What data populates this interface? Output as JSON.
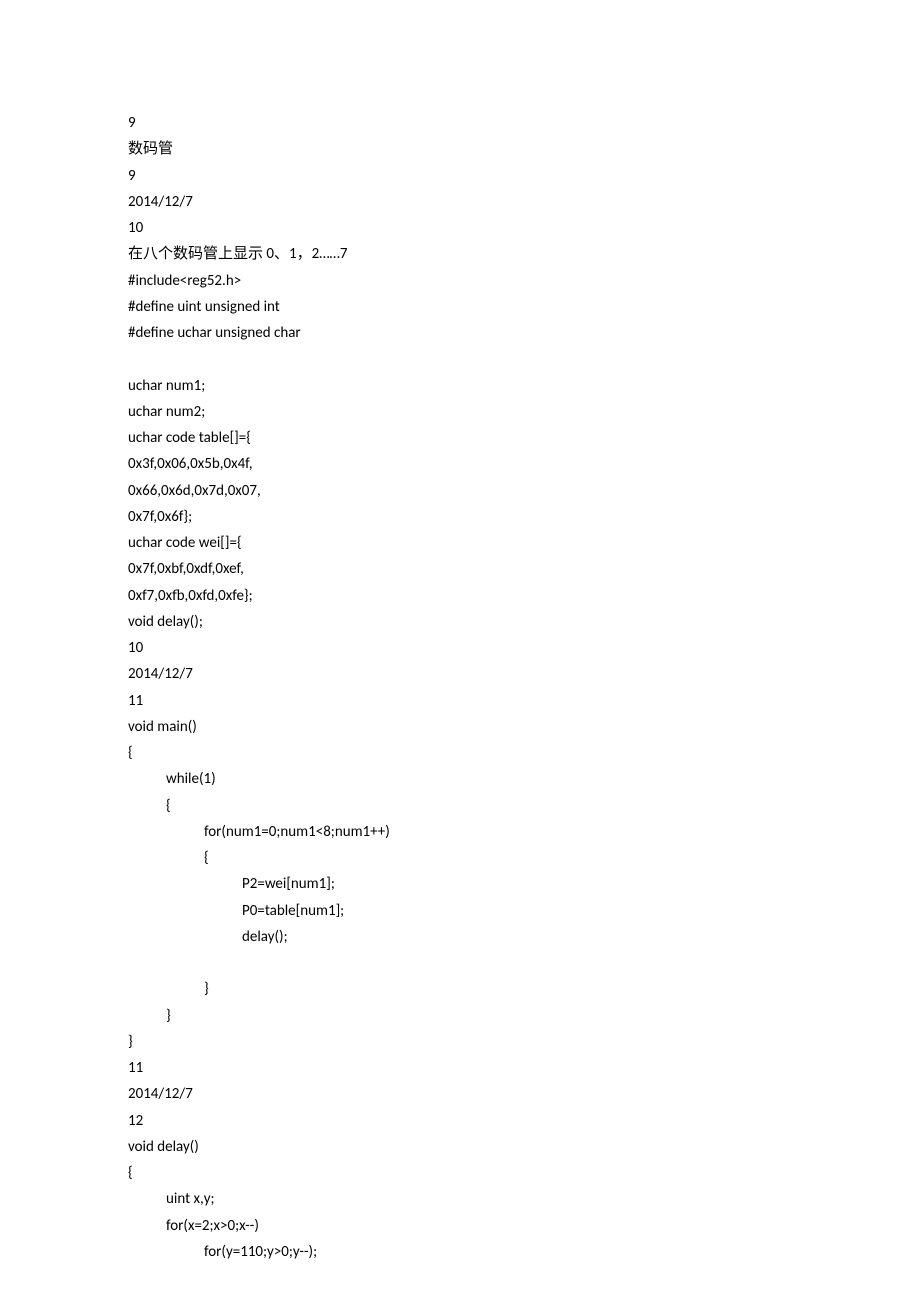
{
  "lines": [
    {
      "text": "9",
      "indent": 0
    },
    {
      "text": "数码管",
      "indent": 0
    },
    {
      "text": "9",
      "indent": 0
    },
    {
      "text": "2014/12/7",
      "indent": 0
    },
    {
      "text": "10",
      "indent": 0
    },
    {
      "text": "在八个数码管上显示 0、1，2……7",
      "indent": 0
    },
    {
      "text": "#include<reg52.h>",
      "indent": 0
    },
    {
      "text": "#define uint unsigned int",
      "indent": 0
    },
    {
      "text": "#define uchar unsigned char",
      "indent": 0
    },
    {
      "text": " ",
      "indent": 0
    },
    {
      "text": "uchar num1;",
      "indent": 0
    },
    {
      "text": "uchar num2;",
      "indent": 0
    },
    {
      "text": "uchar code table[]={",
      "indent": 0
    },
    {
      "text": "0x3f,0x06,0x5b,0x4f,",
      "indent": 0
    },
    {
      "text": "0x66,0x6d,0x7d,0x07,",
      "indent": 0
    },
    {
      "text": "0x7f,0x6f};",
      "indent": 0
    },
    {
      "text": "uchar code wei[]={",
      "indent": 0
    },
    {
      "text": "0x7f,0xbf,0xdf,0xef,",
      "indent": 0
    },
    {
      "text": "0xf7,0xfb,0xfd,0xfe};",
      "indent": 0
    },
    {
      "text": "void delay();",
      "indent": 0
    },
    {
      "text": "10",
      "indent": 0
    },
    {
      "text": "2014/12/7",
      "indent": 0
    },
    {
      "text": "11",
      "indent": 0
    },
    {
      "text": "void main()",
      "indent": 0
    },
    {
      "text": "{",
      "indent": 0
    },
    {
      "text": "while(1)",
      "indent": 1
    },
    {
      "text": "{",
      "indent": 1
    },
    {
      "text": "for(num1=0;num1<8;num1++)",
      "indent": 2
    },
    {
      "text": "{",
      "indent": 2
    },
    {
      "text": "P2=wei[num1];",
      "indent": 3
    },
    {
      "text": "P0=table[num1];",
      "indent": 3
    },
    {
      "text": "delay();",
      "indent": 3
    },
    {
      "text": " ",
      "indent": 0
    },
    {
      "text": "}",
      "indent": 2
    },
    {
      "text": "}",
      "indent": 1
    },
    {
      "text": "}",
      "indent": 0
    },
    {
      "text": "11",
      "indent": 0
    },
    {
      "text": "2014/12/7",
      "indent": 0
    },
    {
      "text": "12",
      "indent": 0
    },
    {
      "text": "void delay()",
      "indent": 0
    },
    {
      "text": "{",
      "indent": 0
    },
    {
      "text": "uint x,y;",
      "indent": 1
    },
    {
      "text": "for(x=2;x>0;x--)",
      "indent": 1
    },
    {
      "text": "for(y=110;y>0;y--);",
      "indent": 2
    }
  ]
}
